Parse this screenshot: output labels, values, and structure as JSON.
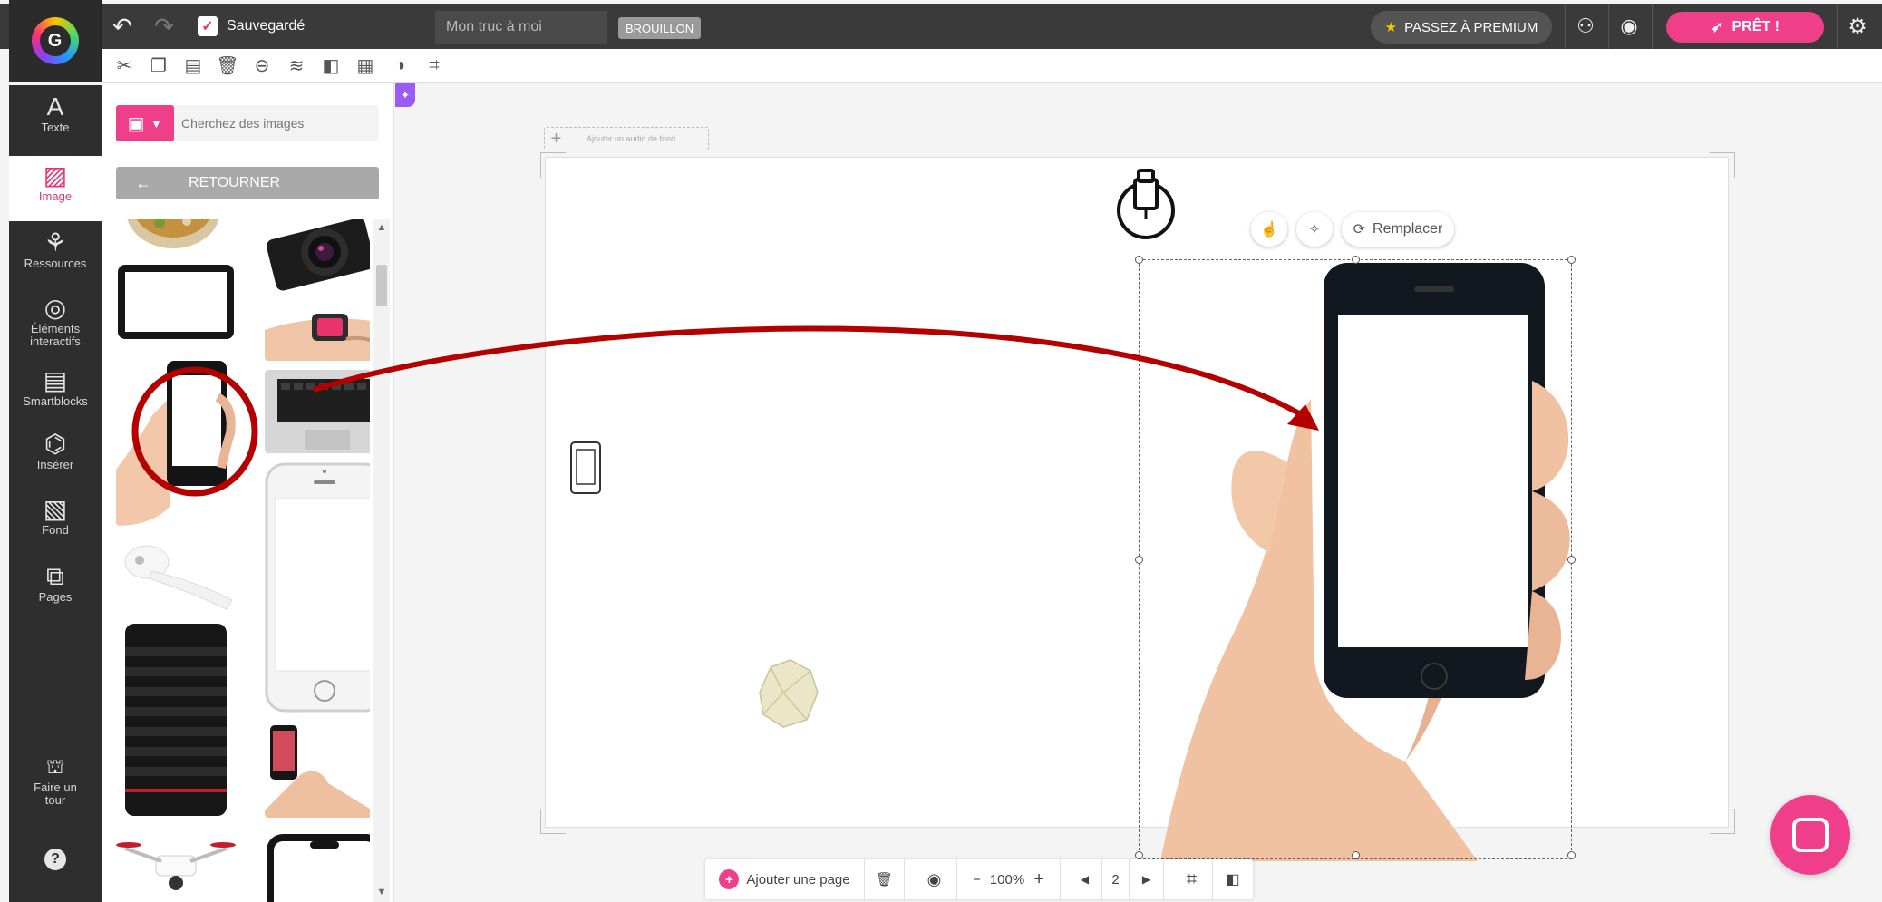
{
  "topbar": {
    "saved_label": "Sauvegardé",
    "project_title": "Mon truc à moi",
    "status_badge": "BROUILLON",
    "premium_label": "PASSEZ À PREMIUM",
    "ready_label": "PRÊT !"
  },
  "sidebar": {
    "items": [
      {
        "label": "Texte",
        "icon": "text-icon"
      },
      {
        "label": "Image",
        "icon": "image-icon"
      },
      {
        "label": "Ressources",
        "icon": "resources-icon"
      },
      {
        "label": "Éléments interactifs",
        "icon": "interactive-icon"
      },
      {
        "label": "Smartblocks",
        "icon": "smartblocks-icon"
      },
      {
        "label": "Insérer",
        "icon": "insert-icon"
      },
      {
        "label": "Fond",
        "icon": "background-icon"
      },
      {
        "label": "Pages",
        "icon": "pages-icon"
      },
      {
        "label": "Faire un tour",
        "icon": "tour-icon"
      }
    ],
    "active": "Image"
  },
  "panel": {
    "search_placeholder": "Cherchez des images",
    "back_label": "RETOURNER"
  },
  "canvas": {
    "audio_label": "Ajouter un audio de fond",
    "replace_label": "Remplacer"
  },
  "bottom_bar": {
    "add_page_label": "Ajouter une page",
    "zoom_minus": "−",
    "zoom_level": "100%",
    "zoom_plus": "+",
    "page_number": "2"
  },
  "colors": {
    "accent": "#ef3f8a",
    "annotation": "#b50000"
  }
}
